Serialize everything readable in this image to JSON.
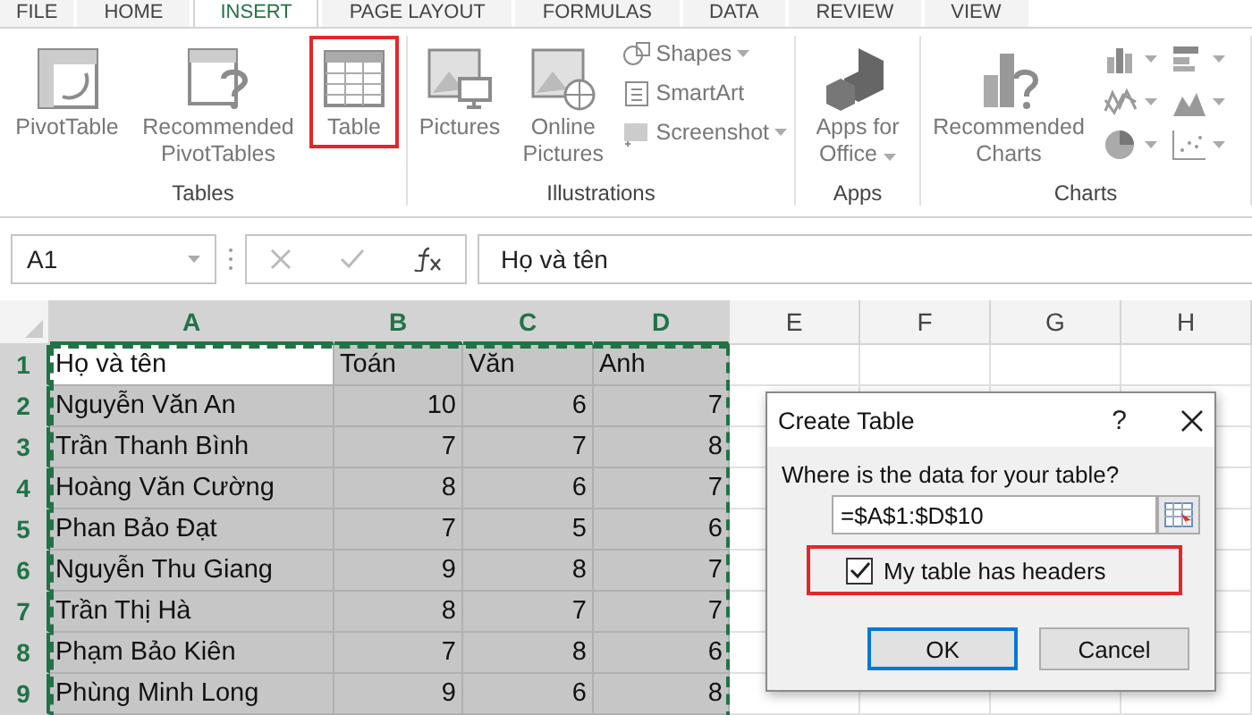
{
  "ribbon_tabs": [
    {
      "label": "FILE",
      "selected": false
    },
    {
      "label": "HOME",
      "selected": false
    },
    {
      "label": "INSERT",
      "selected": true
    },
    {
      "label": "PAGE LAYOUT",
      "selected": false
    },
    {
      "label": "FORMULAS",
      "selected": false
    },
    {
      "label": "DATA",
      "selected": false
    },
    {
      "label": "REVIEW",
      "selected": false
    },
    {
      "label": "VIEW",
      "selected": false
    }
  ],
  "ribbon_groups": [
    {
      "label": "Tables",
      "items": [
        {
          "kind": "large",
          "label": "PivotTable",
          "has_menu": false
        },
        {
          "kind": "large",
          "label": "Recommended PivotTables",
          "has_menu": false
        },
        {
          "kind": "large",
          "label": "Table",
          "highlighted": true,
          "has_menu": false
        }
      ]
    },
    {
      "label": "Illustrations",
      "items": [
        {
          "kind": "large",
          "label": "Pictures",
          "has_menu": false
        },
        {
          "kind": "large",
          "label": "Online Pictures",
          "has_menu": false
        },
        {
          "kind": "small",
          "label": "Shapes",
          "has_menu": true
        },
        {
          "kind": "small",
          "label": "SmartArt",
          "has_menu": false
        },
        {
          "kind": "small",
          "label": "Screenshot",
          "has_menu": true
        }
      ]
    },
    {
      "label": "Apps",
      "items": [
        {
          "kind": "large",
          "label": "Apps for Office",
          "has_menu": true
        }
      ]
    },
    {
      "label": "Charts",
      "items": [
        {
          "kind": "large",
          "label": "Recommended Charts",
          "has_menu": false
        },
        {
          "kind": "chart_gallery",
          "has_menu": true
        }
      ]
    }
  ],
  "formula_bar": {
    "name_box": "A1",
    "formula": "Họ và tên"
  },
  "sheet": {
    "columns": [
      {
        "label": "A",
        "selected": true
      },
      {
        "label": "B",
        "selected": true
      },
      {
        "label": "C",
        "selected": true
      },
      {
        "label": "D",
        "selected": true
      },
      {
        "label": "E",
        "selected": false
      },
      {
        "label": "F",
        "selected": false
      },
      {
        "label": "G",
        "selected": false
      },
      {
        "label": "H",
        "selected": false
      }
    ],
    "rows": [
      {
        "number": "1",
        "selected": true,
        "cells": [
          "Họ và tên",
          "Toán",
          "Văn",
          "Anh"
        ]
      },
      {
        "number": "2",
        "selected": true,
        "cells": [
          "Nguyễn Văn An",
          "10",
          "6",
          "7"
        ]
      },
      {
        "number": "3",
        "selected": true,
        "cells": [
          "Trần Thanh Bình",
          "7",
          "7",
          "8"
        ]
      },
      {
        "number": "4",
        "selected": true,
        "cells": [
          "Hoàng Văn Cường",
          "8",
          "6",
          "7"
        ]
      },
      {
        "number": "5",
        "selected": true,
        "cells": [
          "Phan Bảo Đạt",
          "7",
          "5",
          "6"
        ]
      },
      {
        "number": "6",
        "selected": true,
        "cells": [
          "Nguyễn Thu Giang",
          "9",
          "8",
          "7"
        ]
      },
      {
        "number": "7",
        "selected": true,
        "cells": [
          "Trần Thị Hà",
          "8",
          "7",
          "7"
        ]
      },
      {
        "number": "8",
        "selected": true,
        "cells": [
          "Phạm Bảo Kiên",
          "7",
          "8",
          "6"
        ]
      },
      {
        "number": "9",
        "selected": true,
        "cells": [
          "Phùng Minh Long",
          "9",
          "6",
          "8"
        ]
      }
    ]
  },
  "dialog": {
    "title": "Create Table",
    "help": "?",
    "prompt": "Where is the data for your table?",
    "range": "=$A$1:$D$10",
    "checkbox": {
      "label": "My table has headers",
      "checked": true,
      "highlighted": true
    },
    "buttons": [
      {
        "label": "OK",
        "default": true
      },
      {
        "label": "Cancel",
        "default": false
      }
    ]
  }
}
